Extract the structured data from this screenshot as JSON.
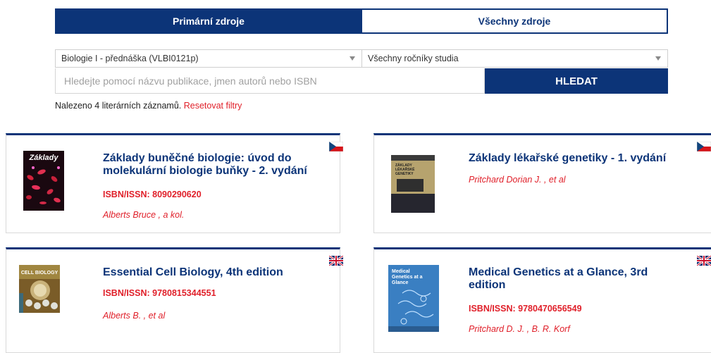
{
  "tabs": {
    "primary": "Primární zdroje",
    "all": "Všechny zdroje"
  },
  "filters": {
    "course": "Biologie I - přednáška (VLBI0121p)",
    "year": "Všechny ročníky studia"
  },
  "search": {
    "placeholder": "Hledejte pomocí názvu publikace, jmen autorů nebo ISBN",
    "button": "HLEDAT"
  },
  "results": {
    "count_text": "Nalezeno 4 literárních záznamů.",
    "reset": "Resetovat filtry"
  },
  "books": [
    {
      "title": "Základy buněčné biologie: úvod do molekulární biologie buňky - 2. vydání",
      "isbn": "ISBN/ISSN: 8090290620",
      "authors": "Alberts Bruce , a kol.",
      "language": "cs",
      "cover_text": "Základy"
    },
    {
      "title": "Základy lékařské genetiky - 1. vydání",
      "isbn": "",
      "authors": "Pritchard Dorian J. , et al",
      "language": "cs",
      "cover_text": "ZÁKLADY LÉKAŘSKÉ GENETIKY"
    },
    {
      "title": "Essential Cell Biology, 4th edition",
      "isbn": "ISBN/ISSN: 9780815344551",
      "authors": "Alberts B. , et al",
      "language": "en",
      "cover_text": "CELL BIOLOGY"
    },
    {
      "title": "Medical Genetics at a Glance, 3rd edition",
      "isbn": "ISBN/ISSN: 9780470656549",
      "authors": "Pritchard D. J. , B. R. Korf",
      "language": "en",
      "cover_text": "Medical Genetics at a Glance"
    }
  ],
  "colors": {
    "navy": "#0c3478",
    "accent_red": "#e0202a"
  }
}
